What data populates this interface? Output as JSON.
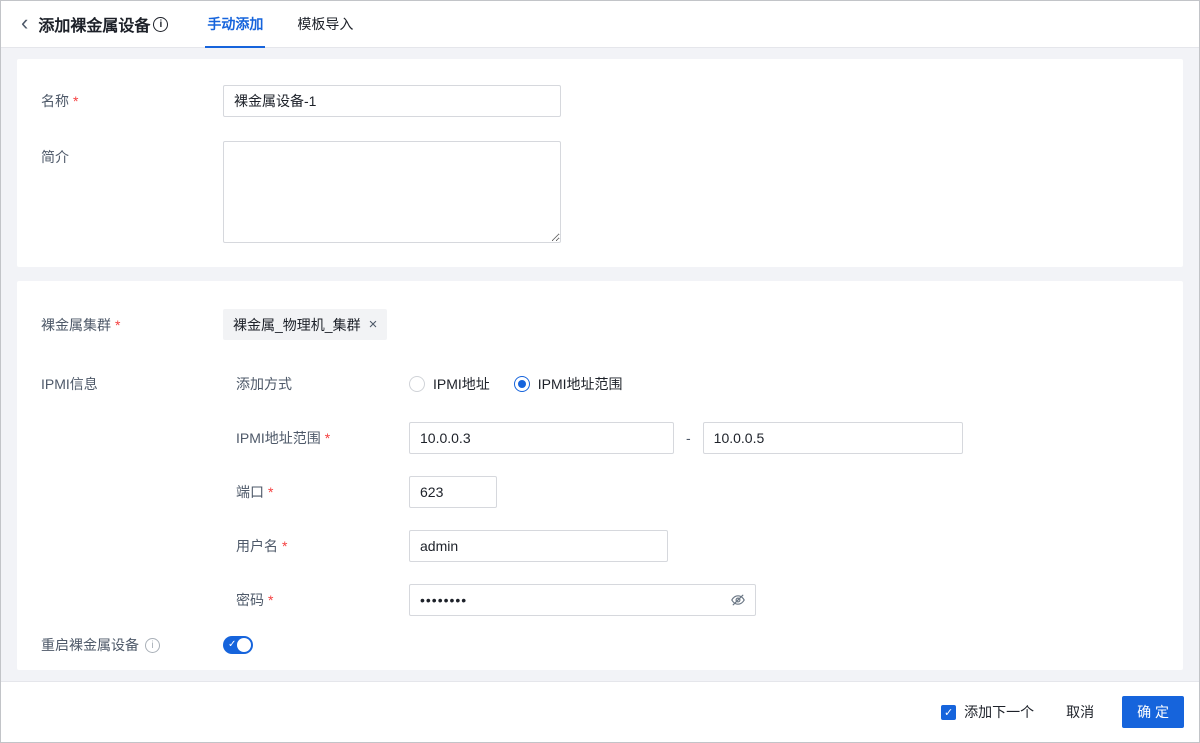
{
  "colors": {
    "accent": "#1664dc",
    "required": "#f53f3f"
  },
  "required_marker": "*",
  "header": {
    "back_icon": "‹",
    "title": "添加裸金属设备",
    "info_icon": "i",
    "tabs": [
      {
        "label": "手动添加",
        "active": true
      },
      {
        "label": "模板导入",
        "active": false
      }
    ]
  },
  "basic_section": {
    "name": {
      "label": "名称",
      "value": "裸金属设备-1",
      "required": true
    },
    "description": {
      "label": "简介",
      "value": ""
    }
  },
  "cluster_section": {
    "label": "裸金属集群",
    "required": true,
    "selected_tag": "裸金属_物理机_集群",
    "tag_remove": "×"
  },
  "ipmi_section": {
    "label": "IPMI信息",
    "method": {
      "label": "添加方式",
      "options": [
        {
          "label": "IPMI地址",
          "selected": false
        },
        {
          "label": "IPMI地址范围",
          "selected": true
        }
      ]
    },
    "range": {
      "label": "IPMI地址范围",
      "required": true,
      "start": "10.0.0.3",
      "separator": "-",
      "end": "10.0.0.5"
    },
    "port": {
      "label": "端口",
      "required": true,
      "value": "623"
    },
    "username": {
      "label": "用户名",
      "required": true,
      "value": "admin"
    },
    "password": {
      "label": "密码",
      "required": true,
      "value": "••••••••"
    }
  },
  "reboot": {
    "label": "重启裸金属设备",
    "info_icon": "i",
    "enabled": true,
    "check_mark": "✓"
  },
  "footer": {
    "add_next": "添加下一个",
    "checked": true,
    "check_mark": "✓",
    "cancel": "取消",
    "confirm": "确 定"
  }
}
